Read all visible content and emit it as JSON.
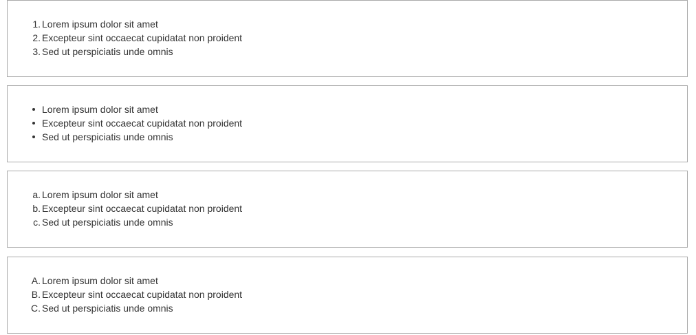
{
  "lists": [
    {
      "style": "decimal",
      "items": [
        {
          "marker": "1.",
          "text": "Lorem ipsum dolor sit amet"
        },
        {
          "marker": "2.",
          "text": "Excepteur sint occaecat cupidatat non proident"
        },
        {
          "marker": "3.",
          "text": "Sed ut perspiciatis unde omnis"
        }
      ]
    },
    {
      "style": "disc",
      "items": [
        {
          "marker": "",
          "text": "Lorem ipsum dolor sit amet"
        },
        {
          "marker": "",
          "text": "Excepteur sint occaecat cupidatat non proident"
        },
        {
          "marker": "",
          "text": "Sed ut perspiciatis unde omnis"
        }
      ]
    },
    {
      "style": "lower-alpha",
      "items": [
        {
          "marker": "a.",
          "text": "Lorem ipsum dolor sit amet"
        },
        {
          "marker": "b.",
          "text": "Excepteur sint occaecat cupidatat non proident"
        },
        {
          "marker": "c.",
          "text": "Sed ut perspiciatis unde omnis"
        }
      ]
    },
    {
      "style": "upper-alpha",
      "items": [
        {
          "marker": "A.",
          "text": "Lorem ipsum dolor sit amet"
        },
        {
          "marker": "B.",
          "text": "Excepteur sint occaecat cupidatat non proident"
        },
        {
          "marker": "C.",
          "text": "Sed ut perspiciatis unde omnis"
        }
      ]
    }
  ],
  "colors": {
    "text": "#333333",
    "border": "#a9a9a9",
    "background": "#ffffff"
  }
}
